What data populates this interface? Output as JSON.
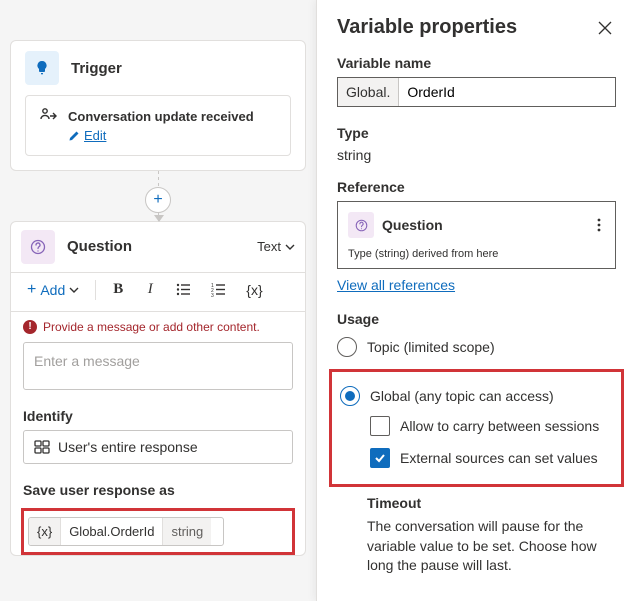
{
  "canvas": {
    "trigger": {
      "title": "Trigger",
      "eventTitle": "Conversation update received",
      "editLabel": "Edit"
    },
    "question": {
      "title": "Question",
      "outputTypeLabel": "Text",
      "toolbar": {
        "addLabel": "Add"
      },
      "warningText": "Provide a message or add other content.",
      "messagePlaceholder": "Enter a message",
      "identifyLabel": "Identify",
      "identifyValue": "User's entire response",
      "saveAsLabel": "Save user response as",
      "savedVar": {
        "scopePrefix": "{x}",
        "name": "Global.OrderId",
        "type": "string"
      }
    }
  },
  "panel": {
    "title": "Variable properties",
    "varName": {
      "label": "Variable name",
      "prefix": "Global.",
      "value": "OrderId"
    },
    "type": {
      "label": "Type",
      "value": "string"
    },
    "reference": {
      "label": "Reference",
      "source": "Question",
      "derivedText": "Type (string) derived from here",
      "viewAllLink": "View all references"
    },
    "usage": {
      "label": "Usage",
      "topicLabel": "Topic (limited scope)",
      "globalLabel": "Global (any topic can access)",
      "carryLabel": "Allow to carry between sessions",
      "externalLabel": "External sources can set values"
    },
    "timeout": {
      "label": "Timeout",
      "description": "The conversation will pause for the variable value to be set. Choose how long the pause will last."
    }
  }
}
